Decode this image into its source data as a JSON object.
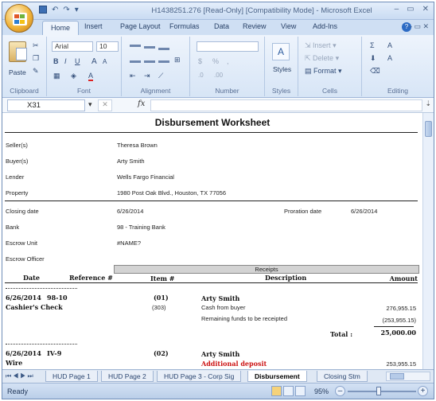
{
  "window": {
    "title": "H1438251.276  [Read-Only]  [Compatibility Mode] - Microsoft Excel",
    "qat": [
      "↶",
      "↷",
      "▾"
    ],
    "controls": [
      "–",
      "▭",
      "✕"
    ]
  },
  "ribbon_tabs": [
    "Home",
    "Insert",
    "Page Layout",
    "Formulas",
    "Data",
    "Review",
    "View",
    "Add-Ins"
  ],
  "active_tab": "Home",
  "ribbon": {
    "clipboard": {
      "label": "Clipboard",
      "paste": "Paste"
    },
    "font": {
      "label": "Font",
      "name": "Arial",
      "size": "10",
      "bold": "B",
      "italic": "I",
      "underline": "U",
      "grow": "A",
      "shrink": "A",
      "font_color": "A"
    },
    "alignment": {
      "label": "Alignment"
    },
    "number": {
      "label": "Number",
      "currency": "$",
      "percent": "%",
      "comma": ",",
      "dec_inc": ".0",
      "dec_dec": ".00"
    },
    "styles": {
      "label": "Styles"
    },
    "cells": {
      "label": "Cells",
      "insert": "Insert",
      "delete": "Delete",
      "format": "Format"
    },
    "editing": {
      "label": "Editing",
      "sum": "Σ",
      "sort": "A",
      "find": "A"
    }
  },
  "formula_bar": {
    "name_box": "X31",
    "fx": "fx",
    "formula": ""
  },
  "sheet": {
    "title": "Disbursement Worksheet",
    "fields": [
      {
        "label": "Seller(s)",
        "value": "Theresa Brown"
      },
      {
        "label": "Buyer(s)",
        "value": "Arty Smith"
      },
      {
        "label": "Lender",
        "value": "Wells Fargo Financial"
      },
      {
        "label": "Property",
        "value": "1980 Post Oak Blvd., Houston, TX 77056"
      }
    ],
    "closing": [
      {
        "label": "Closing date",
        "value": "6/26/2014"
      },
      {
        "label": "Bank",
        "value": "98 - Training Bank"
      },
      {
        "label": "Escrow Unit",
        "value": "#NAME?"
      },
      {
        "label": "Escrow Officer",
        "value": ""
      }
    ],
    "proration": {
      "label": "Proration date",
      "value": "6/26/2014"
    },
    "receipts_label": "Receipts",
    "columns": [
      "Date",
      "Reference #",
      "Item #",
      "Description",
      "Amount"
    ],
    "entries": [
      {
        "date": "6/26/2014",
        "ref": "98-10",
        "item": "(01)",
        "party": "Arty Smith",
        "type": "Cashier's Check",
        "lines": [
          {
            "item": "(303)",
            "desc": "Cash from buyer",
            "amount": "276,955.15"
          },
          {
            "item": "",
            "desc": "Remaining funds to be receipted",
            "amount": "(253,955.15)"
          }
        ],
        "total_label": "Total :",
        "total": "25,000.00"
      },
      {
        "date": "6/26/2014",
        "ref": "IV-9",
        "item": "(02)",
        "party": "Arty Smith",
        "type": "Wire",
        "lines": [
          {
            "item": "",
            "desc": "Additional deposit",
            "amount": "253,955.15"
          }
        ]
      }
    ]
  },
  "sheet_tabs": [
    "HUD Page 1",
    "HUD Page 2",
    "HUD Page 3 - Corp Sig",
    "Disbursement",
    "Closing Stm"
  ],
  "active_sheet": "Disbursement",
  "status": {
    "text": "Ready",
    "zoom": "95%",
    "zoom_minus": "–",
    "zoom_plus": "+"
  }
}
